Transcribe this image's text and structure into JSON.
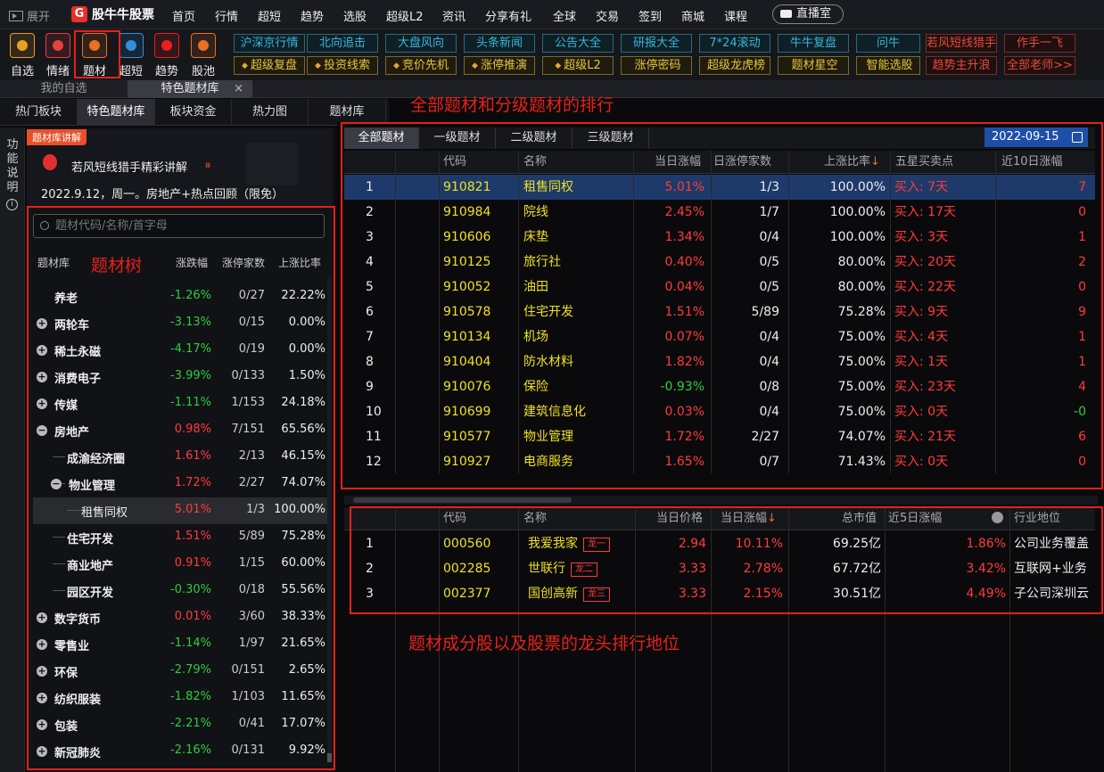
{
  "topmenu": {
    "expand_label": "展开",
    "logo_letter": "G",
    "brand": "股牛牛股票",
    "items": [
      "首页",
      "行情",
      "超短",
      "趋势",
      "选股",
      "超级L2",
      "资讯",
      "分享有礼",
      "全球",
      "交易",
      "签到",
      "商城",
      "课程"
    ],
    "live_label": "直播室"
  },
  "toolbar": {
    "tools": [
      {
        "label": "自选",
        "icon": "add-watchlist-icon",
        "color": "#e8a020"
      },
      {
        "label": "情绪",
        "icon": "heart-icon",
        "color": "#e84040"
      },
      {
        "label": "题材",
        "icon": "theme-cluster-icon",
        "color": "#e87020"
      },
      {
        "label": "超短",
        "icon": "folder-icon",
        "color": "#3090e0"
      },
      {
        "label": "趋势",
        "icon": "target-icon",
        "color": "#e82020"
      },
      {
        "label": "股池",
        "icon": "chart-icon",
        "color": "#e87020"
      }
    ],
    "quick_row1": [
      "沪深京行情",
      "北向追击",
      "大盘风向",
      "头条新闻",
      "公告大全",
      "研报大全",
      "7*24滚动",
      "牛牛复盘",
      "问牛",
      "若风短线猎手",
      "作手一飞"
    ],
    "quick_row2": [
      "超级复盘",
      "投资线索",
      "竞价先机",
      "涨停推演",
      "超级L2",
      "涨停密码",
      "超级龙虎榜",
      "题材星空",
      "智能选股",
      "趋势主升浪",
      "全部老师>>"
    ]
  },
  "page_tabs": {
    "my_watchlist": "我的自选",
    "special": "特色题材库",
    "close": "×"
  },
  "sub_tabs": [
    "热门板块",
    "特色题材库",
    "板块资金",
    "热力图",
    "题材库"
  ],
  "side_strip": "功能说明",
  "banner": {
    "tag": "题材库讲解",
    "title": "若风短线猎手精彩讲解",
    "subtitle": "2022.9.12，周一。房地产+热点回顾（限免）"
  },
  "search": {
    "placeholder": "题材代码/名称/首字母"
  },
  "tree": {
    "headers": {
      "name": "题材库",
      "change": "涨跌幅",
      "limitup": "涨停家数",
      "ratio": "上涨比率"
    },
    "rows": [
      {
        "name": "养老",
        "change": "-1.26%",
        "limitup": "0/27",
        "ratio": "22.22%",
        "level": 0,
        "expander": "none",
        "dir": "dn"
      },
      {
        "name": "两轮车",
        "change": "-3.13%",
        "limitup": "0/15",
        "ratio": "0.00%",
        "level": 0,
        "expander": "+",
        "dir": "dn"
      },
      {
        "name": "稀土永磁",
        "change": "-4.17%",
        "limitup": "0/19",
        "ratio": "0.00%",
        "level": 0,
        "expander": "+",
        "dir": "dn"
      },
      {
        "name": "消费电子",
        "change": "-3.99%",
        "limitup": "0/133",
        "ratio": "1.50%",
        "level": 0,
        "expander": "+",
        "dir": "dn"
      },
      {
        "name": "传媒",
        "change": "-1.11%",
        "limitup": "1/153",
        "ratio": "24.18%",
        "level": 0,
        "expander": "+",
        "dir": "dn"
      },
      {
        "name": "房地产",
        "change": "0.98%",
        "limitup": "7/151",
        "ratio": "65.56%",
        "level": 0,
        "expander": "-",
        "dir": "up"
      },
      {
        "name": "成渝经济圈",
        "change": "1.61%",
        "limitup": "2/13",
        "ratio": "46.15%",
        "level": 1,
        "expander": "none",
        "dir": "up"
      },
      {
        "name": "物业管理",
        "change": "1.72%",
        "limitup": "2/27",
        "ratio": "74.07%",
        "level": 1,
        "expander": "-",
        "dir": "up"
      },
      {
        "name": "租售同权",
        "change": "5.01%",
        "limitup": "1/3",
        "ratio": "100.00%",
        "level": 2,
        "expander": "none",
        "dir": "up",
        "selected": true
      },
      {
        "name": "住宅开发",
        "change": "1.51%",
        "limitup": "5/89",
        "ratio": "75.28%",
        "level": 1,
        "expander": "none",
        "dir": "up"
      },
      {
        "name": "商业地产",
        "change": "0.91%",
        "limitup": "1/15",
        "ratio": "60.00%",
        "level": 1,
        "expander": "none",
        "dir": "up"
      },
      {
        "name": "园区开发",
        "change": "-0.30%",
        "limitup": "0/18",
        "ratio": "55.56%",
        "level": 1,
        "expander": "none",
        "dir": "dn"
      },
      {
        "name": "数字货币",
        "change": "0.01%",
        "limitup": "3/60",
        "ratio": "38.33%",
        "level": 0,
        "expander": "+",
        "dir": "up"
      },
      {
        "name": "零售业",
        "change": "-1.14%",
        "limitup": "1/97",
        "ratio": "21.65%",
        "level": 0,
        "expander": "+",
        "dir": "dn"
      },
      {
        "name": "环保",
        "change": "-2.79%",
        "limitup": "0/151",
        "ratio": "2.65%",
        "level": 0,
        "expander": "+",
        "dir": "dn"
      },
      {
        "name": "纺织服装",
        "change": "-1.82%",
        "limitup": "1/103",
        "ratio": "11.65%",
        "level": 0,
        "expander": "+",
        "dir": "dn"
      },
      {
        "name": "包装",
        "change": "-2.21%",
        "limitup": "0/41",
        "ratio": "17.07%",
        "level": 0,
        "expander": "+",
        "dir": "dn"
      },
      {
        "name": "新冠肺炎",
        "change": "-2.16%",
        "limitup": "0/131",
        "ratio": "9.92%",
        "level": 0,
        "expander": "+",
        "dir": "dn"
      }
    ]
  },
  "annotations": {
    "ranking": "全部题材和分级题材的排行",
    "tree": "题材树",
    "components": "题材成分股以及股票的龙头排行地位"
  },
  "ranking": {
    "tabs": [
      "全部题材",
      "一级题材",
      "二级题材",
      "三级题材"
    ],
    "date": "2022-09-15",
    "headers": {
      "code": "代码",
      "name": "名称",
      "change": "当日涨幅",
      "limitup": "日涨停家数",
      "ratio": "上涨比率",
      "sort_arrow": "↓",
      "signal": "五星买卖点",
      "ten_day": "近10日涨幅"
    },
    "rows": [
      {
        "idx": "1",
        "code": "910821",
        "name": "租售同权",
        "change": "5.01%",
        "dir": "up",
        "limitup": "1/3",
        "ratio": "100.00%",
        "signal": "买入: 7天",
        "ten": "7",
        "tendir": "up"
      },
      {
        "idx": "2",
        "code": "910984",
        "name": "院线",
        "change": "2.45%",
        "dir": "up",
        "limitup": "1/7",
        "ratio": "100.00%",
        "signal": "买入: 17天",
        "ten": "0",
        "tendir": "up"
      },
      {
        "idx": "3",
        "code": "910606",
        "name": "床垫",
        "change": "1.34%",
        "dir": "up",
        "limitup": "0/4",
        "ratio": "100.00%",
        "signal": "买入: 3天",
        "ten": "1",
        "tendir": "up"
      },
      {
        "idx": "4",
        "code": "910125",
        "name": "旅行社",
        "change": "0.40%",
        "dir": "up",
        "limitup": "0/5",
        "ratio": "80.00%",
        "signal": "买入: 20天",
        "ten": "2",
        "tendir": "up"
      },
      {
        "idx": "5",
        "code": "910052",
        "name": "油田",
        "change": "0.04%",
        "dir": "up",
        "limitup": "0/5",
        "ratio": "80.00%",
        "signal": "买入: 22天",
        "ten": "0",
        "tendir": "up"
      },
      {
        "idx": "6",
        "code": "910578",
        "name": "住宅开发",
        "change": "1.51%",
        "dir": "up",
        "limitup": "5/89",
        "ratio": "75.28%",
        "signal": "买入: 9天",
        "ten": "9",
        "tendir": "up"
      },
      {
        "idx": "7",
        "code": "910134",
        "name": "机场",
        "change": "0.07%",
        "dir": "up",
        "limitup": "0/4",
        "ratio": "75.00%",
        "signal": "买入: 4天",
        "ten": "1",
        "tendir": "up"
      },
      {
        "idx": "8",
        "code": "910404",
        "name": "防水材料",
        "change": "1.82%",
        "dir": "up",
        "limitup": "0/4",
        "ratio": "75.00%",
        "signal": "买入: 1天",
        "ten": "1",
        "tendir": "up"
      },
      {
        "idx": "9",
        "code": "910076",
        "name": "保险",
        "change": "-0.93%",
        "dir": "dn",
        "limitup": "0/8",
        "ratio": "75.00%",
        "signal": "买入: 23天",
        "ten": "4",
        "tendir": "up"
      },
      {
        "idx": "10",
        "code": "910699",
        "name": "建筑信息化",
        "change": "0.03%",
        "dir": "up",
        "limitup": "0/4",
        "ratio": "75.00%",
        "signal": "买入: 0天",
        "ten": "-0",
        "tendir": "dn"
      },
      {
        "idx": "11",
        "code": "910577",
        "name": "物业管理",
        "change": "1.72%",
        "dir": "up",
        "limitup": "2/27",
        "ratio": "74.07%",
        "signal": "买入: 21天",
        "ten": "6",
        "tendir": "up"
      },
      {
        "idx": "12",
        "code": "910927",
        "name": "电商服务",
        "change": "1.65%",
        "dir": "up",
        "limitup": "0/7",
        "ratio": "71.43%",
        "signal": "买入: 0天",
        "ten": "0",
        "tendir": "up"
      }
    ]
  },
  "components": {
    "headers": {
      "code": "代码",
      "name": "名称",
      "price": "当日价格",
      "change": "当日涨幅",
      "sort_arrow": "↓",
      "mcap": "总市值",
      "five_day": "近5日涨幅",
      "industry": "行业地位"
    },
    "rows": [
      {
        "idx": "1",
        "code": "000560",
        "name": "我爱我家",
        "badge": "龙一",
        "price": "2.94",
        "change": "10.11%",
        "mcap": "69.25亿",
        "five": "1.86%",
        "industry": "公司业务覆盖"
      },
      {
        "idx": "2",
        "code": "002285",
        "name": "世联行",
        "badge": "龙二",
        "price": "3.33",
        "change": "2.78%",
        "mcap": "67.72亿",
        "five": "3.42%",
        "industry": "互联网+业务"
      },
      {
        "idx": "3",
        "code": "002377",
        "name": "国创高新",
        "badge": "龙三",
        "price": "3.33",
        "change": "2.15%",
        "mcap": "30.51亿",
        "five": "4.49%",
        "industry": "子公司深圳云"
      }
    ]
  }
}
